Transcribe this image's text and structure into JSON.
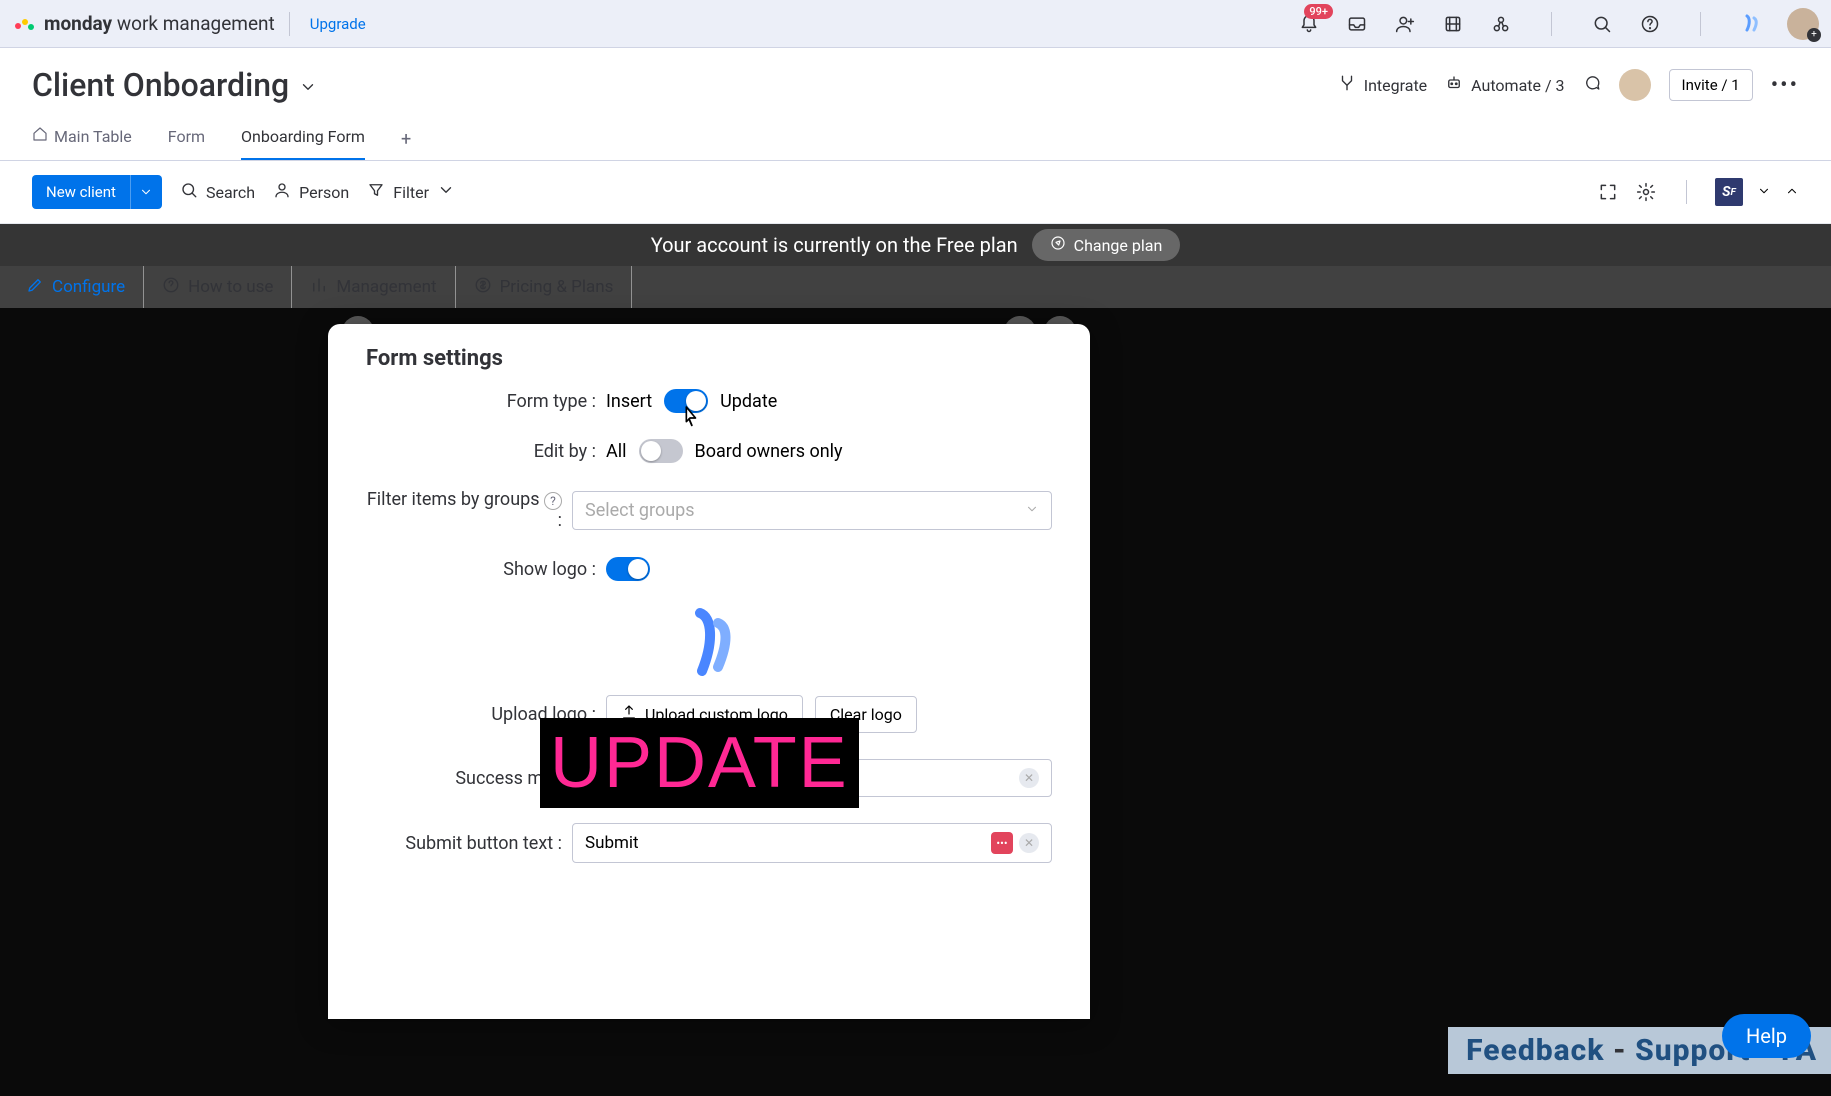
{
  "topbar": {
    "product_bold": "monday",
    "product_rest": " work management",
    "upgrade": "Upgrade",
    "notif_badge": "99+"
  },
  "board": {
    "title": "Client Onboarding",
    "integrate": "Integrate",
    "automate": "Automate / 3",
    "invite": "Invite / 1"
  },
  "tabs": {
    "main_table": "Main Table",
    "form": "Form",
    "onboarding_form": "Onboarding Form"
  },
  "toolbar": {
    "new_client": "New client",
    "search": "Search",
    "person": "Person",
    "filter": "Filter"
  },
  "plan_bar": {
    "text": "Your account is currently on the Free plan",
    "change": "Change plan"
  },
  "subtabs": {
    "configure": "Configure",
    "howto": "How to use",
    "management": "Management",
    "pricing": "Pricing & Plans"
  },
  "form_settings": {
    "title": "Form settings",
    "form_type_label": "Form type :",
    "insert": "Insert",
    "update": "Update",
    "edit_by_label": "Edit by :",
    "all": "All",
    "owners_only": "Board owners only",
    "filter_groups_label": "Filter items by groups",
    "filter_groups_colon": " :",
    "filter_groups_placeholder": "Select groups",
    "show_logo_label": "Show logo :",
    "upload_logo_label": "Upload logo :",
    "upload_btn": "Upload custom logo",
    "clear_btn": "Clear logo",
    "success_label": "Success mes",
    "submit_label": "Submit button text :",
    "submit_value": "Submit"
  },
  "overlay": {
    "text": "UPDATE"
  },
  "footer": {
    "feedback": "Feedback",
    "support": "Support",
    "fa": "FA",
    "help": "Help"
  }
}
